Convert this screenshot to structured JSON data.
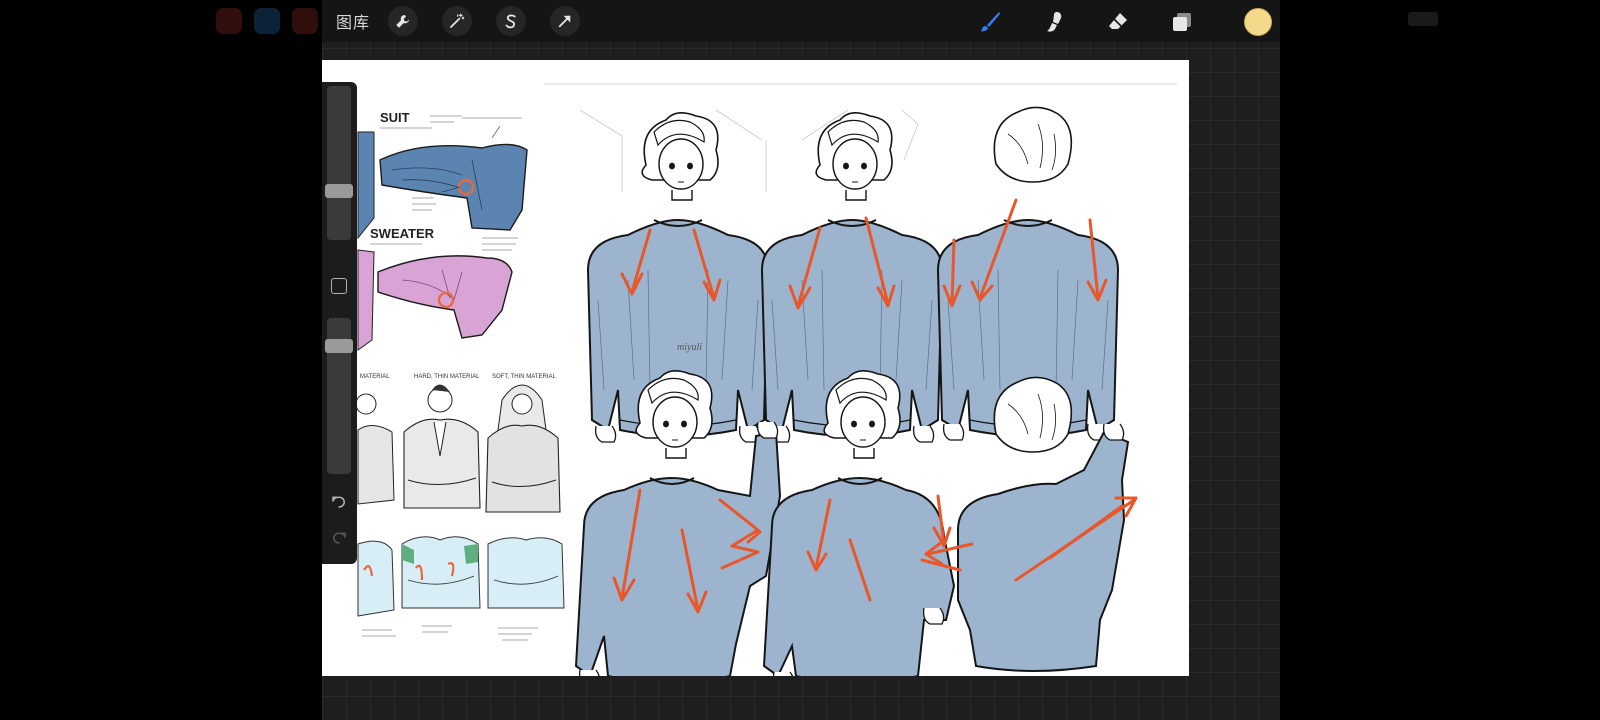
{
  "app": {
    "gallery_label": "图库"
  },
  "toolbar": {
    "left_tools": [
      "wrench-icon",
      "magic-wand-icon",
      "selection-s-icon",
      "arrow-transform-icon"
    ],
    "right_tools": [
      "brush-icon",
      "smudge-icon",
      "eraser-icon",
      "layers-icon"
    ],
    "active_tool": "brush-icon",
    "active_color": "#f5d98a",
    "accent": "#2f7ef5"
  },
  "sidebar": {
    "brush_size_level": 0.3,
    "opacity_level": 0.85
  },
  "canvas": {
    "reference_labels": {
      "suit": "SUIT",
      "sweater": "SWEATER"
    }
  }
}
